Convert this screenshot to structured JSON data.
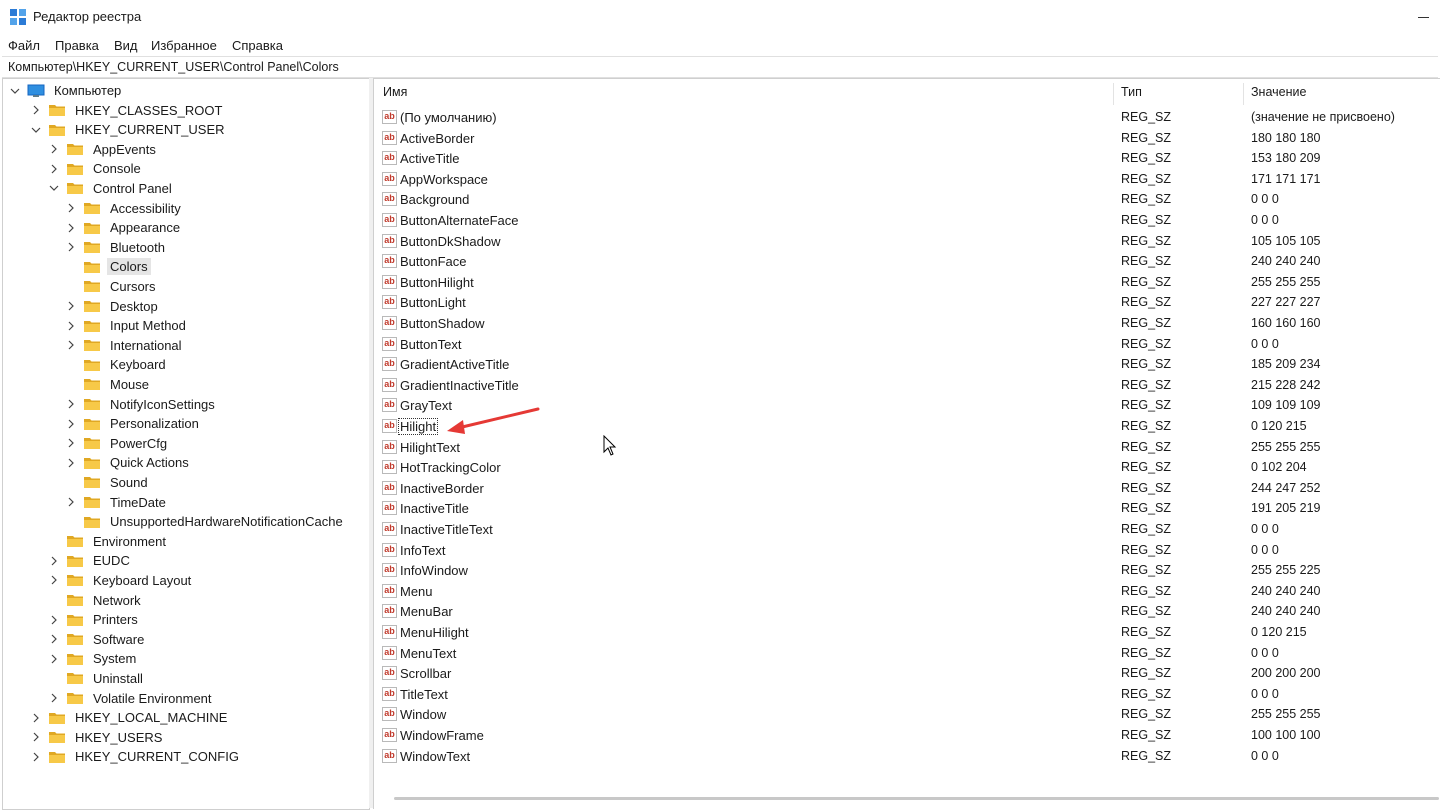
{
  "window": {
    "title": "Редактор реестра"
  },
  "menu": [
    "Файл",
    "Правка",
    "Вид",
    "Избранное",
    "Справка"
  ],
  "address": "Компьютер\\HKEY_CURRENT_USER\\Control Panel\\Colors",
  "tree": {
    "root": "Компьютер",
    "items": [
      {
        "label": "HKEY_CLASSES_ROOT",
        "level": 1,
        "expander": "collapsed"
      },
      {
        "label": "HKEY_CURRENT_USER",
        "level": 1,
        "expander": "expanded"
      },
      {
        "label": "AppEvents",
        "level": 2,
        "expander": "collapsed"
      },
      {
        "label": "Console",
        "level": 2,
        "expander": "collapsed"
      },
      {
        "label": "Control Panel",
        "level": 2,
        "expander": "expanded"
      },
      {
        "label": "Accessibility",
        "level": 3,
        "expander": "collapsed"
      },
      {
        "label": "Appearance",
        "level": 3,
        "expander": "collapsed"
      },
      {
        "label": "Bluetooth",
        "level": 3,
        "expander": "collapsed"
      },
      {
        "label": "Colors",
        "level": 3,
        "expander": "none",
        "selected": true
      },
      {
        "label": "Cursors",
        "level": 3,
        "expander": "none"
      },
      {
        "label": "Desktop",
        "level": 3,
        "expander": "collapsed"
      },
      {
        "label": "Input Method",
        "level": 3,
        "expander": "collapsed"
      },
      {
        "label": "International",
        "level": 3,
        "expander": "collapsed"
      },
      {
        "label": "Keyboard",
        "level": 3,
        "expander": "none"
      },
      {
        "label": "Mouse",
        "level": 3,
        "expander": "none"
      },
      {
        "label": "NotifyIconSettings",
        "level": 3,
        "expander": "collapsed"
      },
      {
        "label": "Personalization",
        "level": 3,
        "expander": "collapsed"
      },
      {
        "label": "PowerCfg",
        "level": 3,
        "expander": "collapsed"
      },
      {
        "label": "Quick Actions",
        "level": 3,
        "expander": "collapsed"
      },
      {
        "label": "Sound",
        "level": 3,
        "expander": "none"
      },
      {
        "label": "TimeDate",
        "level": 3,
        "expander": "collapsed"
      },
      {
        "label": "UnsupportedHardwareNotificationCache",
        "level": 3,
        "expander": "none"
      },
      {
        "label": "Environment",
        "level": 2,
        "expander": "none"
      },
      {
        "label": "EUDC",
        "level": 2,
        "expander": "collapsed"
      },
      {
        "label": "Keyboard Layout",
        "level": 2,
        "expander": "collapsed"
      },
      {
        "label": "Network",
        "level": 2,
        "expander": "none"
      },
      {
        "label": "Printers",
        "level": 2,
        "expander": "collapsed"
      },
      {
        "label": "Software",
        "level": 2,
        "expander": "collapsed"
      },
      {
        "label": "System",
        "level": 2,
        "expander": "collapsed"
      },
      {
        "label": "Uninstall",
        "level": 2,
        "expander": "none"
      },
      {
        "label": "Volatile Environment",
        "level": 2,
        "expander": "collapsed"
      },
      {
        "label": "HKEY_LOCAL_MACHINE",
        "level": 1,
        "expander": "collapsed"
      },
      {
        "label": "HKEY_USERS",
        "level": 1,
        "expander": "collapsed"
      },
      {
        "label": "HKEY_CURRENT_CONFIG",
        "level": 1,
        "expander": "collapsed"
      }
    ]
  },
  "list": {
    "columns": {
      "name": "Имя",
      "type": "Тип",
      "value": "Значение"
    },
    "icon_text": "ab",
    "focused": "Hilight",
    "rows": [
      {
        "name": "(По умолчанию)",
        "type": "REG_SZ",
        "value": "(значение не присвоено)"
      },
      {
        "name": "ActiveBorder",
        "type": "REG_SZ",
        "value": "180 180 180"
      },
      {
        "name": "ActiveTitle",
        "type": "REG_SZ",
        "value": "153 180 209"
      },
      {
        "name": "AppWorkspace",
        "type": "REG_SZ",
        "value": "171 171 171"
      },
      {
        "name": "Background",
        "type": "REG_SZ",
        "value": "0 0 0"
      },
      {
        "name": "ButtonAlternateFace",
        "type": "REG_SZ",
        "value": "0 0 0"
      },
      {
        "name": "ButtonDkShadow",
        "type": "REG_SZ",
        "value": "105 105 105"
      },
      {
        "name": "ButtonFace",
        "type": "REG_SZ",
        "value": "240 240 240"
      },
      {
        "name": "ButtonHilight",
        "type": "REG_SZ",
        "value": "255 255 255"
      },
      {
        "name": "ButtonLight",
        "type": "REG_SZ",
        "value": "227 227 227"
      },
      {
        "name": "ButtonShadow",
        "type": "REG_SZ",
        "value": "160 160 160"
      },
      {
        "name": "ButtonText",
        "type": "REG_SZ",
        "value": "0 0 0"
      },
      {
        "name": "GradientActiveTitle",
        "type": "REG_SZ",
        "value": "185 209 234"
      },
      {
        "name": "GradientInactiveTitle",
        "type": "REG_SZ",
        "value": "215 228 242"
      },
      {
        "name": "GrayText",
        "type": "REG_SZ",
        "value": "109 109 109"
      },
      {
        "name": "Hilight",
        "type": "REG_SZ",
        "value": "0 120 215"
      },
      {
        "name": "HilightText",
        "type": "REG_SZ",
        "value": "255 255 255"
      },
      {
        "name": "HotTrackingColor",
        "type": "REG_SZ",
        "value": "0 102 204"
      },
      {
        "name": "InactiveBorder",
        "type": "REG_SZ",
        "value": "244 247 252"
      },
      {
        "name": "InactiveTitle",
        "type": "REG_SZ",
        "value": "191 205 219"
      },
      {
        "name": "InactiveTitleText",
        "type": "REG_SZ",
        "value": "0 0 0"
      },
      {
        "name": "InfoText",
        "type": "REG_SZ",
        "value": "0 0 0"
      },
      {
        "name": "InfoWindow",
        "type": "REG_SZ",
        "value": "255 255 225"
      },
      {
        "name": "Menu",
        "type": "REG_SZ",
        "value": "240 240 240"
      },
      {
        "name": "MenuBar",
        "type": "REG_SZ",
        "value": "240 240 240"
      },
      {
        "name": "MenuHilight",
        "type": "REG_SZ",
        "value": "0 120 215"
      },
      {
        "name": "MenuText",
        "type": "REG_SZ",
        "value": "0 0 0"
      },
      {
        "name": "Scrollbar",
        "type": "REG_SZ",
        "value": "200 200 200"
      },
      {
        "name": "TitleText",
        "type": "REG_SZ",
        "value": "0 0 0"
      },
      {
        "name": "Window",
        "type": "REG_SZ",
        "value": "255 255 255"
      },
      {
        "name": "WindowFrame",
        "type": "REG_SZ",
        "value": "100 100 100"
      },
      {
        "name": "WindowText",
        "type": "REG_SZ",
        "value": "0 0 0"
      }
    ]
  },
  "colors": {
    "folder": "#f7c948",
    "folder_dark": "#e0a823",
    "annotation_arrow": "#e53935",
    "selection": "#e5e5e5",
    "ab_icon_text": "#c0392b"
  },
  "icons": {
    "app": "registry-editor-icon",
    "computer": "computer-icon",
    "folder": "folder-icon",
    "value": "string-value-icon",
    "expander_collapsed": "chevron-right-icon",
    "expander_expanded": "chevron-down-icon"
  }
}
